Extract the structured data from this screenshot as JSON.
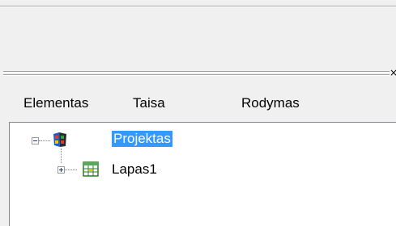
{
  "panel": {
    "close_glyph": "×"
  },
  "menu": {
    "items": [
      {
        "label": "Elementas"
      },
      {
        "label": "Taisa"
      },
      {
        "label": "Rodymas"
      }
    ]
  },
  "tree": {
    "nodes": [
      {
        "label": "Projektas",
        "icon": "project-icon",
        "expander": "minus",
        "selected": true
      },
      {
        "label": "Lapas1",
        "icon": "sheet-icon",
        "expander": "plus",
        "selected": false
      }
    ]
  }
}
